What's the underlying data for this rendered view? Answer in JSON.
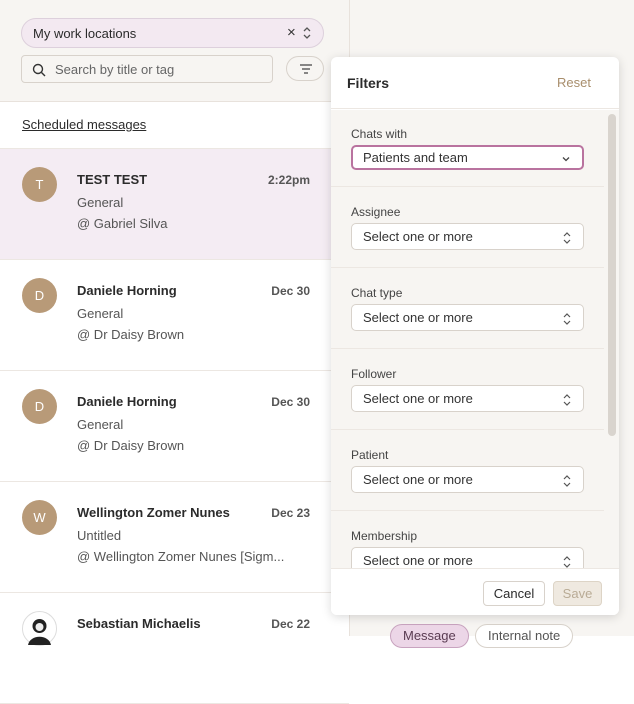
{
  "location_select": {
    "value": "My work locations",
    "clear": "×"
  },
  "search": {
    "placeholder": "Search by title or tag"
  },
  "scheduled_link": "Scheduled messages",
  "conversations": [
    {
      "initial": "T",
      "name": "TEST TEST",
      "date": "2:22pm",
      "subject": "General",
      "who": "@ Gabriel Silva"
    },
    {
      "initial": "D",
      "name": "Daniele Horning",
      "date": "Dec 30",
      "subject": "General",
      "who": "@ Dr Daisy Brown"
    },
    {
      "initial": "D",
      "name": "Daniele Horning",
      "date": "Dec 30",
      "subject": "General",
      "who": "@ Dr Daisy Brown"
    },
    {
      "initial": "W",
      "name": "Wellington Zomer Nunes",
      "date": "Dec 23",
      "subject": "Untitled",
      "who": "@ Wellington Zomer Nunes [Sigm..."
    },
    {
      "initial": "",
      "name": "Sebastian Michaelis",
      "date": "Dec 22",
      "subject": "",
      "who": ""
    }
  ],
  "composer_chips": {
    "message": "Message",
    "internal_note": "Internal note"
  },
  "filters": {
    "title": "Filters",
    "reset": "Reset",
    "chats_with": {
      "label": "Chats with",
      "value": "Patients and team"
    },
    "assignee": {
      "label": "Assignee",
      "value": "Select one or more"
    },
    "chat_type": {
      "label": "Chat type",
      "value": "Select one or more"
    },
    "follower": {
      "label": "Follower",
      "value": "Select one or more"
    },
    "patient": {
      "label": "Patient",
      "value": "Select one or more"
    },
    "membership": {
      "label": "Membership",
      "value": "Select one or more"
    },
    "cancel": "Cancel",
    "save": "Save"
  }
}
